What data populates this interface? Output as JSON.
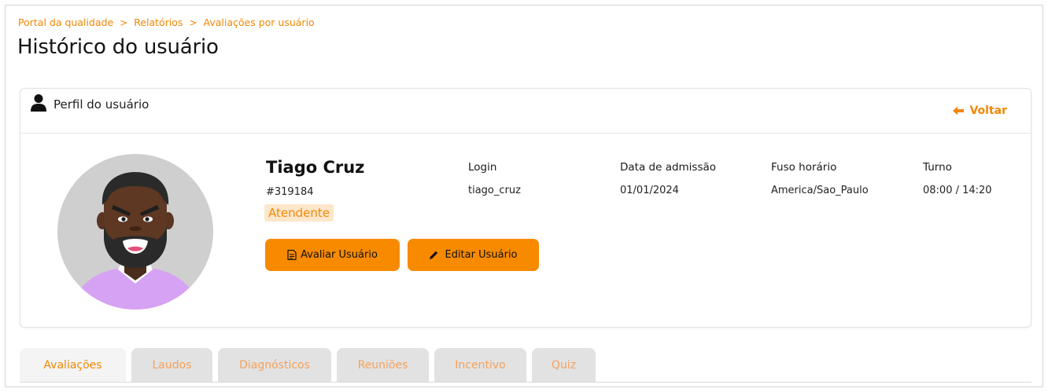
{
  "breadcrumb": {
    "items": [
      "Portal da qualidade",
      "Relatórios",
      "Avaliações por usuário"
    ],
    "separator": ">"
  },
  "page": {
    "title": "Histórico do usuário"
  },
  "profile_card": {
    "title": "Perfil do usuário",
    "back_label": "Voltar",
    "icons": {
      "header": "user-icon",
      "back": "arrow-left-icon"
    }
  },
  "user": {
    "name": "Tiago Cruz",
    "id": "#319184",
    "role": "Atendente"
  },
  "actions": {
    "evaluate_label": "Avaliar Usuário",
    "evaluate_icon": "document-icon",
    "edit_label": "Editar Usuário",
    "edit_icon": "pencil-icon"
  },
  "info": [
    {
      "label": "Login",
      "value": "tiago_cruz"
    },
    {
      "label": "Data de admissão",
      "value": "01/01/2024"
    },
    {
      "label": "Fuso horário",
      "value": "America/Sao_Paulo"
    },
    {
      "label": "Turno",
      "value": "08:00 / 14:20"
    }
  ],
  "tabs": [
    {
      "label": "Avaliações",
      "active": true
    },
    {
      "label": "Laudos",
      "active": false
    },
    {
      "label": "Diagnósticos",
      "active": false
    },
    {
      "label": "Reuniões",
      "active": false
    },
    {
      "label": "Incentivo",
      "active": false
    },
    {
      "label": "Quiz",
      "active": false
    }
  ],
  "colors": {
    "accent": "#f28705",
    "button": "#f88a00",
    "badge_bg": "#fde7cb",
    "tab_bg": "#e2e2e2"
  }
}
